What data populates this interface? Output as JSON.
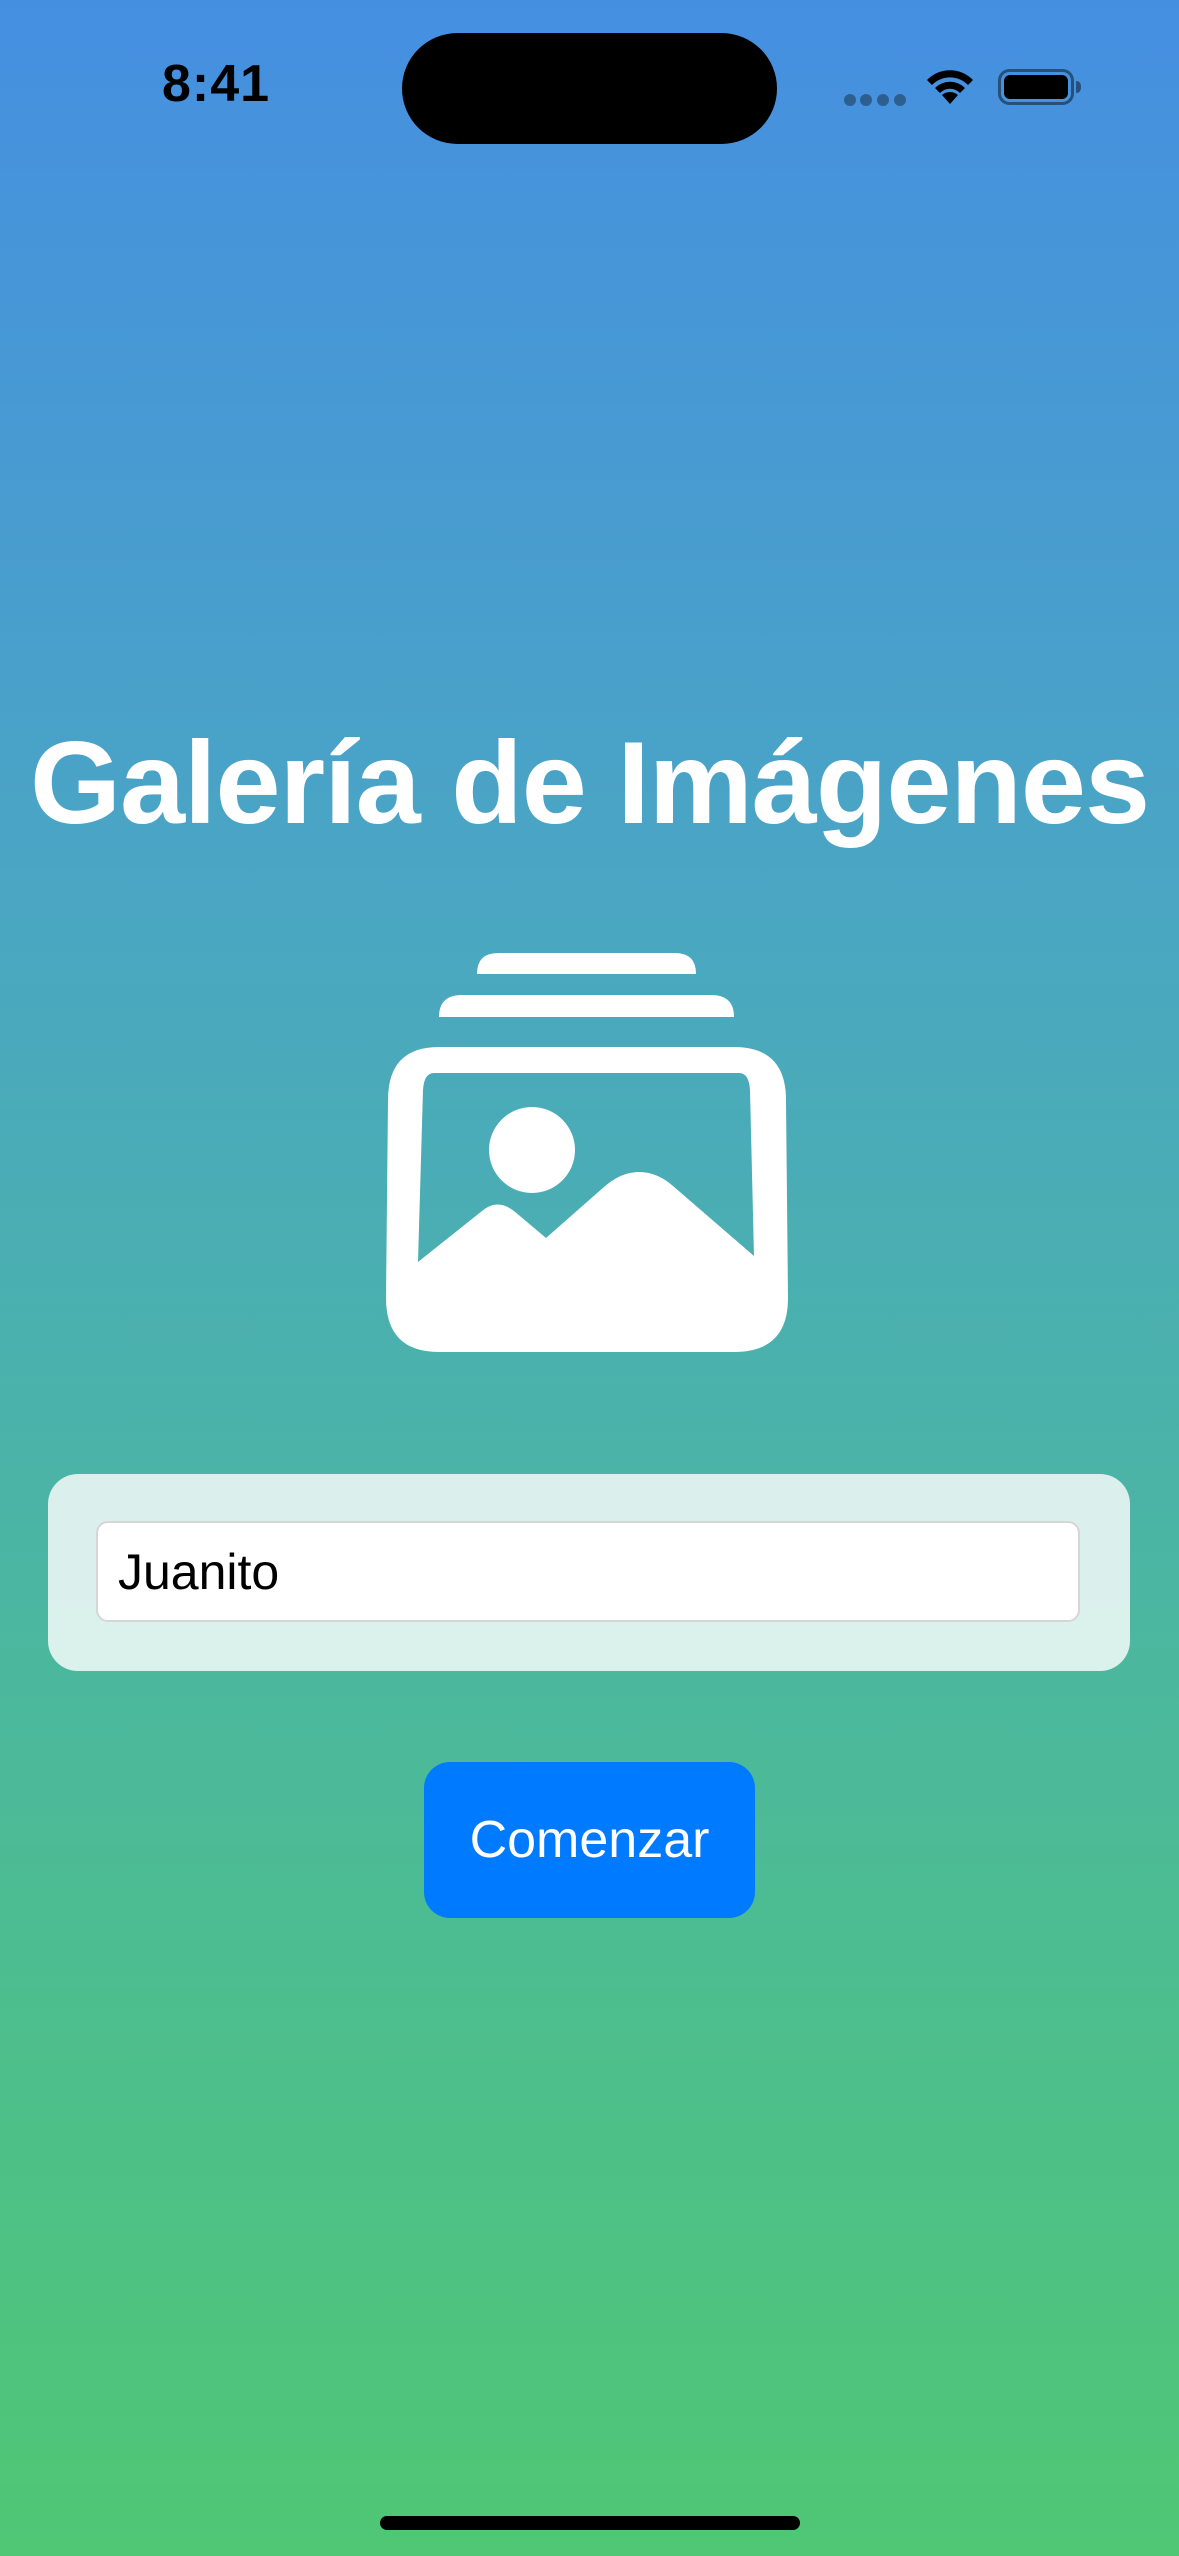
{
  "status_bar": {
    "time": "8:41",
    "icons": [
      "cellular-signal-icon",
      "wifi-icon",
      "battery-icon"
    ]
  },
  "welcome": {
    "title": "Galería de Imágenes",
    "hero_icon": "photo-stack-icon"
  },
  "form": {
    "name_value": "Juanito",
    "start_button_label": "Comenzar"
  },
  "colors": {
    "gradient_top": "#458fe1",
    "gradient_bottom": "#4fc774",
    "button": "#007aff",
    "panel": "#ddf0ee"
  }
}
